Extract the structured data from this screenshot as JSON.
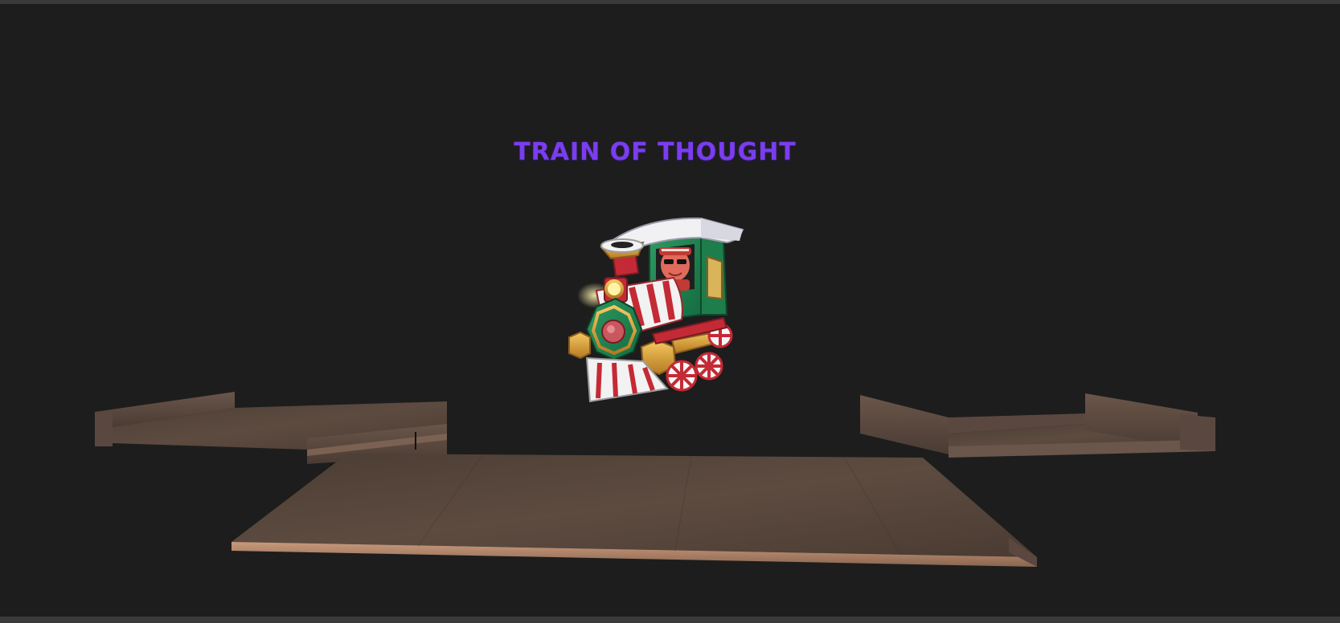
{
  "game": {
    "title": "TRAIN OF THOUGHT"
  },
  "colors": {
    "background": "#1d1d1d",
    "frame_bar": "#3a3a3a",
    "title": "#7a3df0",
    "wood": "#5c4a3f"
  },
  "icons": {
    "train": "train-icon",
    "conductor": "conductor-icon"
  }
}
